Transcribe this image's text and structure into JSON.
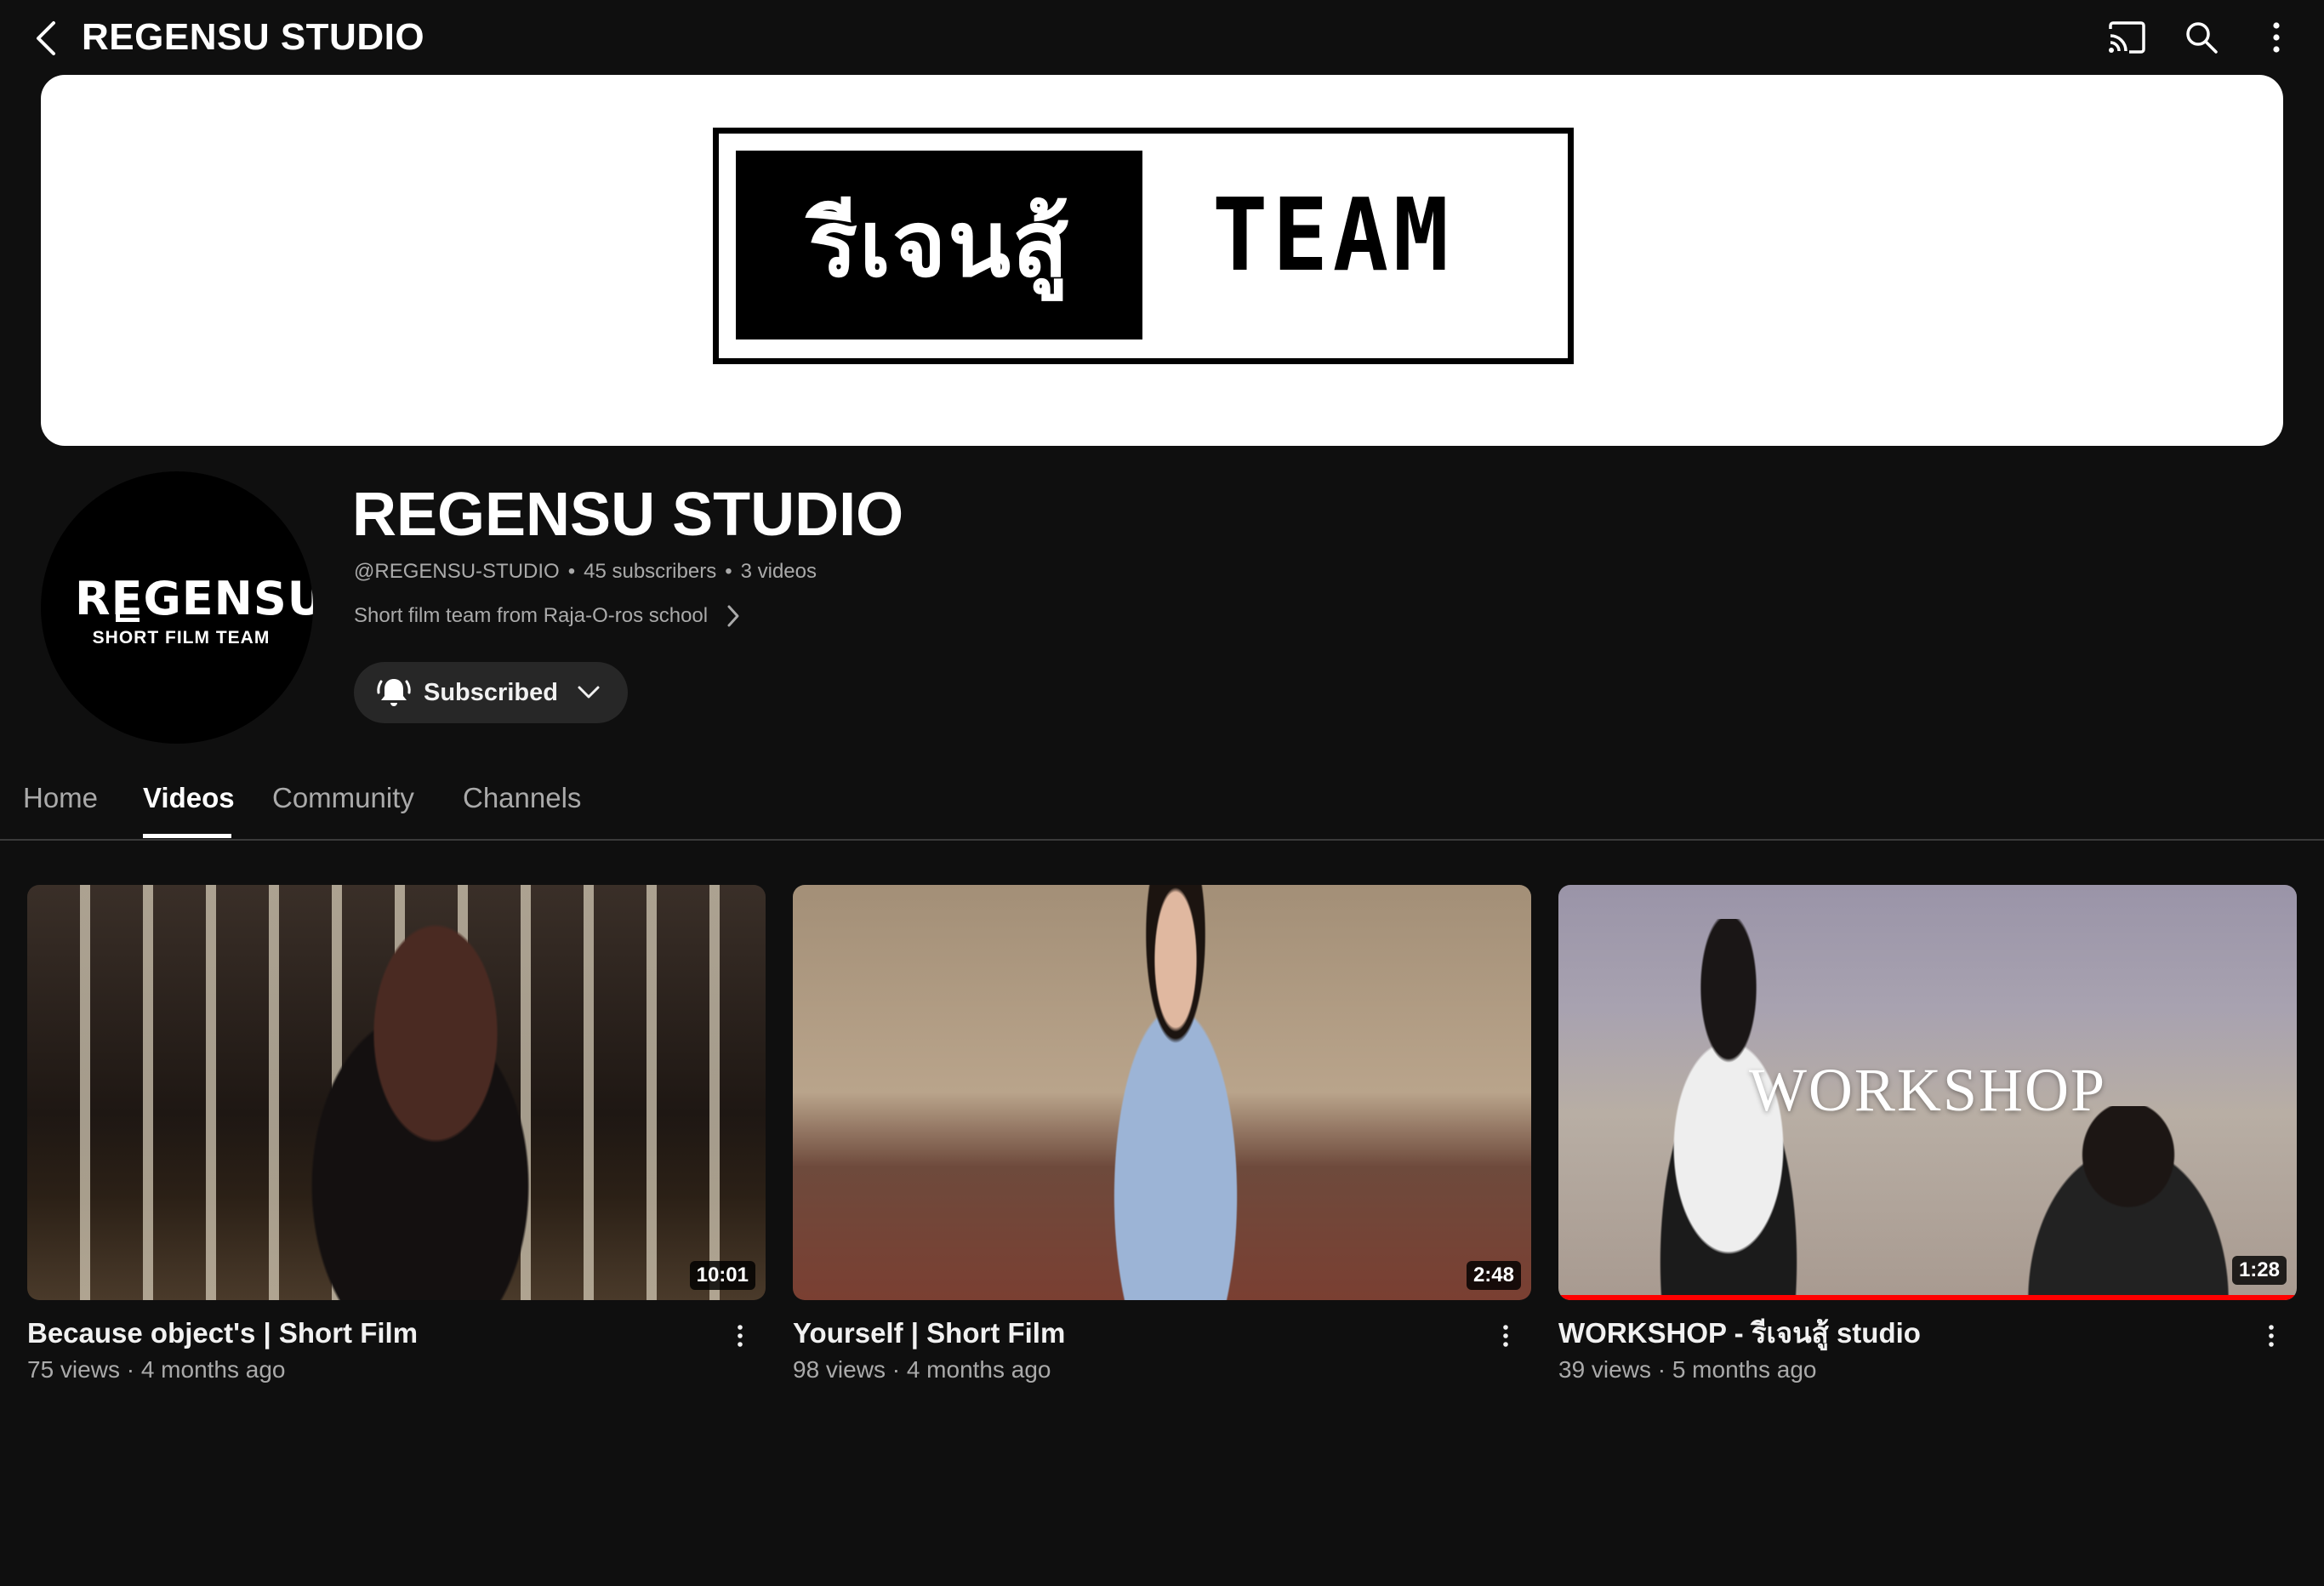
{
  "topbar": {
    "title": "REGENSU STUDIO",
    "icons": [
      "back-arrow-icon",
      "cast-icon",
      "search-icon",
      "more-vert-icon"
    ]
  },
  "banner": {
    "thai_text": "รีเจนสู้",
    "team_text": "TEAM"
  },
  "avatar": {
    "logo_text": "REGENSU",
    "logo_sub": "SHORT FILM TEAM"
  },
  "channel": {
    "name": "REGENSU STUDIO",
    "handle": "@REGENSU-STUDIO",
    "subscribers": "45 subscribers",
    "video_count": "3 videos",
    "description": "Short film team from Raja-O-ros school"
  },
  "subscribe": {
    "label": "Subscribed"
  },
  "tabs": [
    {
      "label": "Home",
      "active": false
    },
    {
      "label": "Videos",
      "active": true
    },
    {
      "label": "Community",
      "active": false
    },
    {
      "label": "Channels",
      "active": false
    }
  ],
  "videos": [
    {
      "title": "Because object's | Short Film",
      "meta": "75 views · 4 months ago",
      "duration": "10:01"
    },
    {
      "title": "Yourself | Short Film",
      "meta": "98 views · 4 months ago",
      "duration": "2:48"
    },
    {
      "title": "WORKSHOP - รีเจนสู้ studio",
      "meta": "39 views · 5 months ago",
      "duration": "1:28",
      "thumb_overlay_text": "WORKSHOP",
      "watch_progress": 1.0
    }
  ],
  "colors": {
    "background": "#0f0f0f",
    "text_primary": "#f1f1f1",
    "text_secondary": "#aaaaaa",
    "button_bg": "#272727",
    "progress_red": "#ff0000"
  }
}
